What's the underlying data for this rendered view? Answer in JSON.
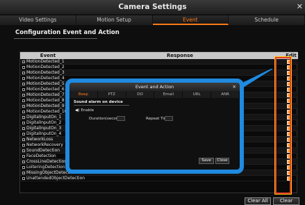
{
  "window": {
    "title": "Camera Settings",
    "close_glyph": "✕"
  },
  "tabs": [
    {
      "label": "Video Settings"
    },
    {
      "label": "Motion Setup"
    },
    {
      "label": "Event",
      "active": true
    },
    {
      "label": "Schedule"
    }
  ],
  "section": {
    "title": "Configuration Event and Action"
  },
  "table": {
    "headers": {
      "event": "Event",
      "response": "Response",
      "edit": "Edit"
    },
    "rows": [
      "MotionDetected_1",
      "MotionDetected_2",
      "MotionDetected_3",
      "MotionDetected_4",
      "MotionDetected_5",
      "MotionDetected_6",
      "MotionDetected_7",
      "MotionDetected_8",
      "MotionDetected_9",
      "MotionDetected_10",
      "DigitalInputOn_1",
      "DigitalInputOn_2",
      "DigitalInputOn_3",
      "DigitalInputOn_4",
      "NetworkLoss",
      "NetworkRecovery",
      "SoundDetection",
      "FaceDetection",
      "CrossLineDetection",
      "LoiteringDetection",
      "MissingObjectDetection",
      "UnattendedObjectDetection"
    ]
  },
  "dialog": {
    "title": "Event and Action",
    "close_glyph": "✕",
    "tabs": [
      {
        "label": "Beep",
        "active": true
      },
      {
        "label": "PTZ"
      },
      {
        "label": "DO"
      },
      {
        "label": "Email"
      },
      {
        "label": "URL"
      },
      {
        "label": "ANR"
      }
    ],
    "section": "Sound alarm on device",
    "enable_label": "Enable",
    "duration_label": "Duration(seconds)",
    "repeat_label": "Repeat Times",
    "save_label": "Save",
    "close_label": "Close"
  },
  "buttons": {
    "clear_all": "Clear All",
    "clear": "Clear"
  },
  "colors": {
    "accent": "#ff7a1a",
    "dialog_border": "#1f8ae0",
    "highlight": "#e63b2e",
    "edit_icon": "#ffa040"
  }
}
